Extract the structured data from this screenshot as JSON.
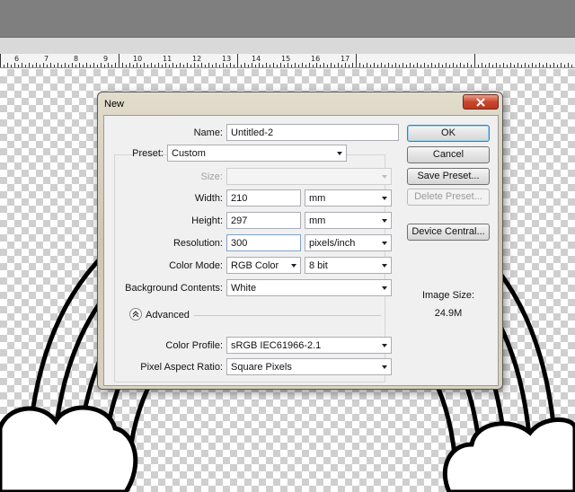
{
  "ruler": {
    "labels": [
      "6",
      "7",
      "8",
      "9",
      "10",
      "11",
      "12",
      "13",
      "14",
      "15",
      "16",
      "17"
    ]
  },
  "dialog": {
    "title": "New",
    "name_label": "Name:",
    "name_value": "Untitled-2",
    "preset_label": "Preset:",
    "preset_value": "Custom",
    "size_label": "Size:",
    "size_value": "",
    "width_label": "Width:",
    "width_value": "210",
    "width_unit": "mm",
    "height_label": "Height:",
    "height_value": "297",
    "height_unit": "mm",
    "resolution_label": "Resolution:",
    "resolution_value": "300",
    "resolution_unit": "pixels/inch",
    "color_mode_label": "Color Mode:",
    "color_mode_value": "RGB Color",
    "bit_depth_value": "8 bit",
    "background_label": "Background Contents:",
    "background_value": "White",
    "advanced_label": "Advanced",
    "color_profile_label": "Color Profile:",
    "color_profile_value": "sRGB IEC61966-2.1",
    "pixel_aspect_label": "Pixel Aspect Ratio:",
    "pixel_aspect_value": "Square Pixels",
    "buttons": {
      "ok": "OK",
      "cancel": "Cancel",
      "save_preset": "Save Preset...",
      "delete_preset": "Delete Preset...",
      "device_central": "Device Central..."
    },
    "image_size_label": "Image Size:",
    "image_size_value": "24.9M"
  },
  "colors": {
    "close_button": "#c8462c",
    "default_button_border": "#3c7fb1"
  },
  "icons": [
    "close-icon",
    "chevron-down-icon",
    "collapse-up-icon"
  ]
}
